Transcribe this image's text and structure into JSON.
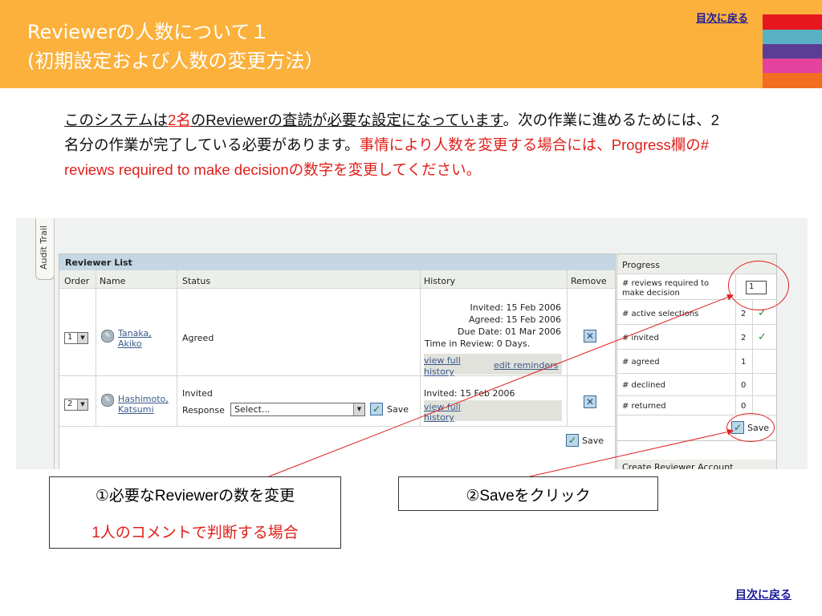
{
  "slide": {
    "title_line1": "Reviewerの人数について１",
    "title_line2": "(初期設定および人数の変更方法）",
    "toc_link_top": "目次に戻る",
    "toc_link_bottom": "目次に戻る",
    "stripe_colors": [
      "#fbb13c",
      "#e8171f",
      "#5ab0c3",
      "#5b3d96",
      "#e5429e",
      "#f26f21"
    ]
  },
  "intro": {
    "p1": "このシステムは",
    "p2": "2名",
    "p3": "のReviewerの査読が必要な設定になっています",
    "p4": "。次の作業に進めるためには、2名分の作業が完了している必要があります。",
    "p5": "事情により人数を変更する場合には、Progress欄の# reviews required to make decisionの数字を変更してください。"
  },
  "app": {
    "audit_tab": "Audit Trail",
    "reviewer_list_title": "Reviewer List",
    "columns": [
      "Order",
      "Name",
      "Status",
      "History",
      "Remove"
    ],
    "rows": [
      {
        "order": "1",
        "name_line1": "Tanaka,",
        "name_line2": "Akiko",
        "status": "Agreed",
        "history": [
          "Invited: 15 Feb 2006",
          "Agreed: 15 Feb 2006",
          "Due Date: 01 Mar 2006",
          "Time in Review: 0 Days."
        ],
        "view_full_1": "view full",
        "view_full_2": "history",
        "edit_reminders": "edit reminders"
      },
      {
        "order": "2",
        "name_line1": "Hashimoto,",
        "name_line2": "Katsumi",
        "status": "Invited",
        "response_label": "Response",
        "response_value": "Select...",
        "response_save": "Save",
        "history": [
          "Invited: 15 Feb 2006"
        ],
        "view_full_1": "view full",
        "view_full_2": "history"
      }
    ],
    "list_save": "Save",
    "progress": {
      "title": "Progress",
      "required_label_1": "# reviews required to",
      "required_label_2": "make decision",
      "required_value": "1",
      "rows": [
        {
          "label": "# active selections",
          "count": "2",
          "tick": "✓"
        },
        {
          "label": "# invited",
          "count": "2",
          "tick": "✓"
        },
        {
          "label": "# agreed",
          "count": "1",
          "tick": ""
        },
        {
          "label": "# declined",
          "count": "0",
          "tick": ""
        },
        {
          "label": "# returned",
          "count": "0",
          "tick": ""
        }
      ],
      "save": "Save",
      "create_account": "Create Reviewer Account"
    }
  },
  "callouts": {
    "box1_line1": "①必要なReviewerの数を変更",
    "box1_line2": "1人のコメントで判断する場合",
    "box2": "②Saveをクリック"
  }
}
